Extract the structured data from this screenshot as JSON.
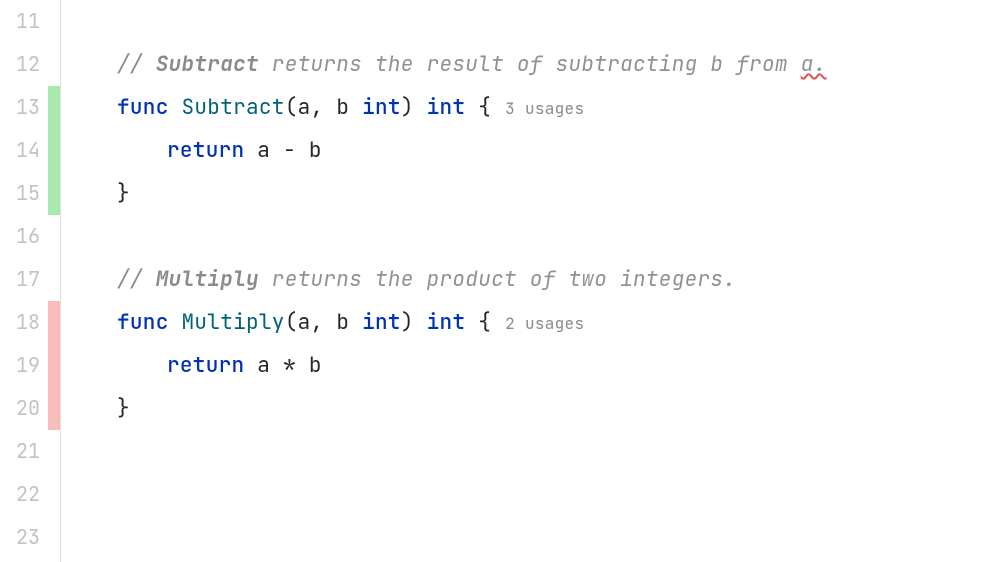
{
  "lines": {
    "l11": "11",
    "l12": "12",
    "l13": "13",
    "l14": "14",
    "l15": "15",
    "l16": "16",
    "l17": "17",
    "l18": "18",
    "l19": "19",
    "l20": "20",
    "l21": "21",
    "l22": "22",
    "l23": "23"
  },
  "code": {
    "subtract": {
      "comment_slash": "// ",
      "comment_name": "Subtract",
      "comment_rest_pre": " returns the result of subtracting b from ",
      "comment_rest_squiggle": "a.",
      "func_kw": "func",
      "func_name": " Subtract",
      "params_open": "(",
      "params_ids": "a, b ",
      "params_type": "int",
      "params_close": ") ",
      "ret_type": "int",
      "brace_open": " {",
      "usages": "3 usages",
      "return_kw": "return",
      "return_expr": " a - b",
      "brace_close": "}"
    },
    "multiply": {
      "comment_slash": "// ",
      "comment_name": "Multiply",
      "comment_rest": " returns the product of two integers.",
      "func_kw": "func",
      "func_name": " Multiply",
      "params_open": "(",
      "params_ids": "a, b ",
      "params_type": "int",
      "params_close": ") ",
      "ret_type": "int",
      "brace_open": " {",
      "usages": "2 usages",
      "return_kw": "return",
      "return_expr": " a * b",
      "brace_close": "}"
    }
  }
}
